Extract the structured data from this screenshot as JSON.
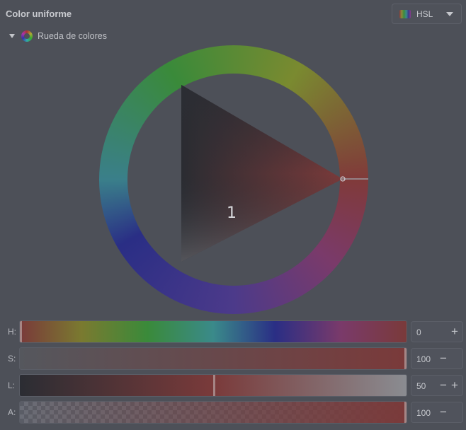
{
  "header": {
    "title": "Color uniforme",
    "mode_select": {
      "value": "HSL",
      "icon": "color-model-icon"
    }
  },
  "section": {
    "label": "Rueda de colores",
    "icon": "color-wheel-icon",
    "expanded": true
  },
  "wheel": {
    "marker_label": "1",
    "hue": 0
  },
  "sliders": [
    {
      "label": "H:",
      "value": "0",
      "buttons": [
        "+"
      ]
    },
    {
      "label": "S:",
      "value": "100",
      "buttons": [
        "−"
      ]
    },
    {
      "label": "L:",
      "value": "50",
      "buttons": [
        "−",
        "+"
      ]
    },
    {
      "label": "A:",
      "value": "100",
      "buttons": [
        "−"
      ]
    }
  ]
}
